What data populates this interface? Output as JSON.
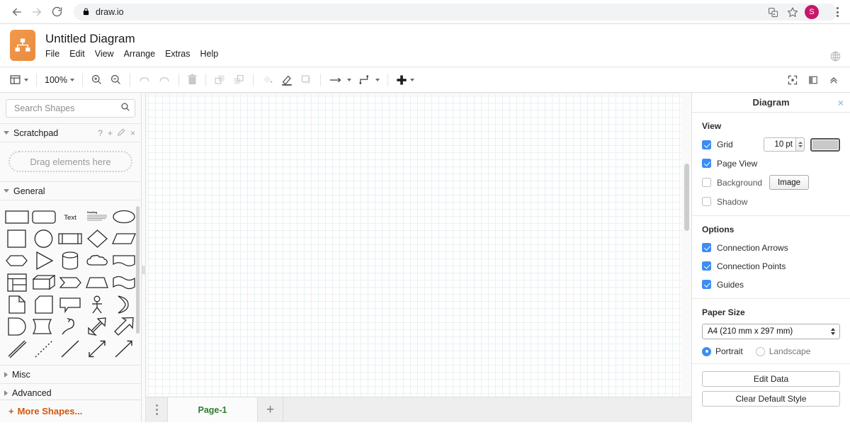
{
  "browser": {
    "back_icon": "arrow-left-icon",
    "forward_icon": "arrow-right-icon",
    "reload_icon": "reload-icon",
    "lock_icon": "lock-icon",
    "url": "draw.io",
    "translate_icon": "translate-icon",
    "bookmark_icon": "star-icon",
    "avatar_initial": "S",
    "menu_icon": "kebab-menu-icon"
  },
  "app": {
    "logo_icon": "drawio-logo-icon",
    "title": "Untitled Diagram",
    "menu": [
      {
        "label": "File"
      },
      {
        "label": "Edit"
      },
      {
        "label": "View"
      },
      {
        "label": "Arrange"
      },
      {
        "label": "Extras"
      },
      {
        "label": "Help"
      }
    ],
    "globe_icon": "globe-icon"
  },
  "toolbar": {
    "view_icon": "view-layout-icon",
    "zoom_level": "100%",
    "zoom_in_icon": "zoom-in-icon",
    "zoom_out_icon": "zoom-out-icon",
    "undo_icon": "undo-icon",
    "redo_icon": "redo-icon",
    "delete_icon": "trash-icon",
    "to_front_icon": "bring-to-front-icon",
    "to_back_icon": "send-to-back-icon",
    "fill_icon": "fill-color-icon",
    "line_icon": "line-color-icon",
    "shadow_icon": "shadow-icon",
    "connection_icon": "connection-arrow-icon",
    "waypoint_icon": "waypoint-icon",
    "insert_icon": "plus-insert-icon",
    "fullscreen_icon": "fullscreen-icon",
    "format_panel_icon": "format-panel-icon",
    "collapse_icon": "chevrons-up-icon"
  },
  "sidebar": {
    "search": {
      "placeholder": "Search Shapes",
      "value": "",
      "icon": "search-icon"
    },
    "scratchpad": {
      "label": "Scratchpad",
      "help_icon": "?",
      "add_icon": "+",
      "edit_icon": "pencil-icon",
      "close_icon": "×",
      "drop_text": "Drag elements here"
    },
    "general": {
      "label": "General",
      "shapes": [
        "rectangle",
        "rounded-rectangle",
        "text",
        "textbox-heading",
        "ellipse",
        "square",
        "circle",
        "process",
        "diamond",
        "parallelogram",
        "hexagon",
        "triangle",
        "cylinder",
        "cloud",
        "document",
        "table",
        "cube",
        "step",
        "trapezoid",
        "tape",
        "note",
        "card",
        "callout",
        "actor",
        "or-shape",
        "internal-storage",
        "data-storage",
        "curve",
        "bidirectional-arrow",
        "arrow",
        "double-line",
        "dashed-line",
        "line",
        "double-arrow-line",
        "directional-line"
      ]
    },
    "misc": {
      "label": "Misc"
    },
    "advanced": {
      "label": "Advanced"
    },
    "more_shapes": {
      "label": "More Shapes...",
      "icon": "plus-icon"
    }
  },
  "format_panel": {
    "header": "Diagram",
    "close_icon": "×",
    "view": {
      "title": "View",
      "grid": {
        "label": "Grid",
        "checked": true,
        "size": "10 pt",
        "color": "#c9c9c9"
      },
      "page_view": {
        "label": "Page View",
        "checked": true
      },
      "background": {
        "label": "Background",
        "checked": false,
        "button": "Image"
      },
      "shadow": {
        "label": "Shadow",
        "checked": false
      }
    },
    "options": {
      "title": "Options",
      "items": [
        {
          "label": "Connection Arrows",
          "checked": true
        },
        {
          "label": "Connection Points",
          "checked": true
        },
        {
          "label": "Guides",
          "checked": true
        }
      ]
    },
    "paper": {
      "title": "Paper Size",
      "selected": "A4 (210 mm x 297 mm)",
      "orientation": [
        {
          "label": "Portrait",
          "checked": true
        },
        {
          "label": "Landscape",
          "checked": false
        }
      ]
    },
    "actions": [
      {
        "label": "Edit Data"
      },
      {
        "label": "Clear Default Style"
      }
    ]
  },
  "tabbar": {
    "menu_icon": "page-menu-icon",
    "pages": [
      {
        "label": "Page-1",
        "active": true
      }
    ],
    "add_label": "+"
  }
}
